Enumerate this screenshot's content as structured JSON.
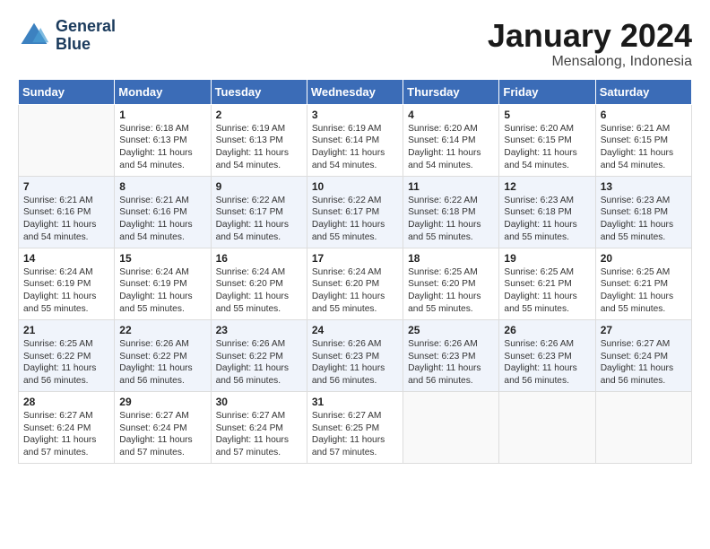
{
  "header": {
    "logo_line1": "General",
    "logo_line2": "Blue",
    "month": "January 2024",
    "location": "Mensalong, Indonesia"
  },
  "days_of_week": [
    "Sunday",
    "Monday",
    "Tuesday",
    "Wednesday",
    "Thursday",
    "Friday",
    "Saturday"
  ],
  "weeks": [
    [
      {
        "day": "",
        "lines": []
      },
      {
        "day": "1",
        "lines": [
          "Sunrise: 6:18 AM",
          "Sunset: 6:13 PM",
          "Daylight: 11 hours",
          "and 54 minutes."
        ]
      },
      {
        "day": "2",
        "lines": [
          "Sunrise: 6:19 AM",
          "Sunset: 6:13 PM",
          "Daylight: 11 hours",
          "and 54 minutes."
        ]
      },
      {
        "day": "3",
        "lines": [
          "Sunrise: 6:19 AM",
          "Sunset: 6:14 PM",
          "Daylight: 11 hours",
          "and 54 minutes."
        ]
      },
      {
        "day": "4",
        "lines": [
          "Sunrise: 6:20 AM",
          "Sunset: 6:14 PM",
          "Daylight: 11 hours",
          "and 54 minutes."
        ]
      },
      {
        "day": "5",
        "lines": [
          "Sunrise: 6:20 AM",
          "Sunset: 6:15 PM",
          "Daylight: 11 hours",
          "and 54 minutes."
        ]
      },
      {
        "day": "6",
        "lines": [
          "Sunrise: 6:21 AM",
          "Sunset: 6:15 PM",
          "Daylight: 11 hours",
          "and 54 minutes."
        ]
      }
    ],
    [
      {
        "day": "7",
        "lines": [
          "Sunrise: 6:21 AM",
          "Sunset: 6:16 PM",
          "Daylight: 11 hours",
          "and 54 minutes."
        ]
      },
      {
        "day": "8",
        "lines": [
          "Sunrise: 6:21 AM",
          "Sunset: 6:16 PM",
          "Daylight: 11 hours",
          "and 54 minutes."
        ]
      },
      {
        "day": "9",
        "lines": [
          "Sunrise: 6:22 AM",
          "Sunset: 6:17 PM",
          "Daylight: 11 hours",
          "and 54 minutes."
        ]
      },
      {
        "day": "10",
        "lines": [
          "Sunrise: 6:22 AM",
          "Sunset: 6:17 PM",
          "Daylight: 11 hours",
          "and 55 minutes."
        ]
      },
      {
        "day": "11",
        "lines": [
          "Sunrise: 6:22 AM",
          "Sunset: 6:18 PM",
          "Daylight: 11 hours",
          "and 55 minutes."
        ]
      },
      {
        "day": "12",
        "lines": [
          "Sunrise: 6:23 AM",
          "Sunset: 6:18 PM",
          "Daylight: 11 hours",
          "and 55 minutes."
        ]
      },
      {
        "day": "13",
        "lines": [
          "Sunrise: 6:23 AM",
          "Sunset: 6:18 PM",
          "Daylight: 11 hours",
          "and 55 minutes."
        ]
      }
    ],
    [
      {
        "day": "14",
        "lines": [
          "Sunrise: 6:24 AM",
          "Sunset: 6:19 PM",
          "Daylight: 11 hours",
          "and 55 minutes."
        ]
      },
      {
        "day": "15",
        "lines": [
          "Sunrise: 6:24 AM",
          "Sunset: 6:19 PM",
          "Daylight: 11 hours",
          "and 55 minutes."
        ]
      },
      {
        "day": "16",
        "lines": [
          "Sunrise: 6:24 AM",
          "Sunset: 6:20 PM",
          "Daylight: 11 hours",
          "and 55 minutes."
        ]
      },
      {
        "day": "17",
        "lines": [
          "Sunrise: 6:24 AM",
          "Sunset: 6:20 PM",
          "Daylight: 11 hours",
          "and 55 minutes."
        ]
      },
      {
        "day": "18",
        "lines": [
          "Sunrise: 6:25 AM",
          "Sunset: 6:20 PM",
          "Daylight: 11 hours",
          "and 55 minutes."
        ]
      },
      {
        "day": "19",
        "lines": [
          "Sunrise: 6:25 AM",
          "Sunset: 6:21 PM",
          "Daylight: 11 hours",
          "and 55 minutes."
        ]
      },
      {
        "day": "20",
        "lines": [
          "Sunrise: 6:25 AM",
          "Sunset: 6:21 PM",
          "Daylight: 11 hours",
          "and 55 minutes."
        ]
      }
    ],
    [
      {
        "day": "21",
        "lines": [
          "Sunrise: 6:25 AM",
          "Sunset: 6:22 PM",
          "Daylight: 11 hours",
          "and 56 minutes."
        ]
      },
      {
        "day": "22",
        "lines": [
          "Sunrise: 6:26 AM",
          "Sunset: 6:22 PM",
          "Daylight: 11 hours",
          "and 56 minutes."
        ]
      },
      {
        "day": "23",
        "lines": [
          "Sunrise: 6:26 AM",
          "Sunset: 6:22 PM",
          "Daylight: 11 hours",
          "and 56 minutes."
        ]
      },
      {
        "day": "24",
        "lines": [
          "Sunrise: 6:26 AM",
          "Sunset: 6:23 PM",
          "Daylight: 11 hours",
          "and 56 minutes."
        ]
      },
      {
        "day": "25",
        "lines": [
          "Sunrise: 6:26 AM",
          "Sunset: 6:23 PM",
          "Daylight: 11 hours",
          "and 56 minutes."
        ]
      },
      {
        "day": "26",
        "lines": [
          "Sunrise: 6:26 AM",
          "Sunset: 6:23 PM",
          "Daylight: 11 hours",
          "and 56 minutes."
        ]
      },
      {
        "day": "27",
        "lines": [
          "Sunrise: 6:27 AM",
          "Sunset: 6:24 PM",
          "Daylight: 11 hours",
          "and 56 minutes."
        ]
      }
    ],
    [
      {
        "day": "28",
        "lines": [
          "Sunrise: 6:27 AM",
          "Sunset: 6:24 PM",
          "Daylight: 11 hours",
          "and 57 minutes."
        ]
      },
      {
        "day": "29",
        "lines": [
          "Sunrise: 6:27 AM",
          "Sunset: 6:24 PM",
          "Daylight: 11 hours",
          "and 57 minutes."
        ]
      },
      {
        "day": "30",
        "lines": [
          "Sunrise: 6:27 AM",
          "Sunset: 6:24 PM",
          "Daylight: 11 hours",
          "and 57 minutes."
        ]
      },
      {
        "day": "31",
        "lines": [
          "Sunrise: 6:27 AM",
          "Sunset: 6:25 PM",
          "Daylight: 11 hours",
          "and 57 minutes."
        ]
      },
      {
        "day": "",
        "lines": []
      },
      {
        "day": "",
        "lines": []
      },
      {
        "day": "",
        "lines": []
      }
    ]
  ]
}
